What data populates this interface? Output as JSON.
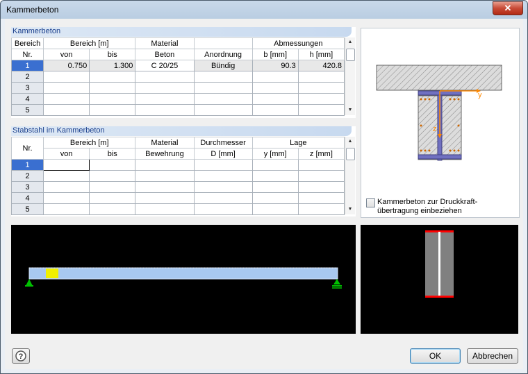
{
  "window": {
    "title": "Kammerbeton",
    "close_glyph": "✕"
  },
  "kammerbeton": {
    "panel_title": "Kammerbeton",
    "header_row1": [
      "Bereich",
      "Bereich [m]",
      "Material",
      "",
      "Abmessungen"
    ],
    "header_row2": [
      "Nr.",
      "von",
      "bis",
      "Beton",
      "Anordnung",
      "b [mm]",
      "h [mm]"
    ],
    "rows": [
      {
        "nr": "1",
        "von": "0.750",
        "bis": "1.300",
        "beton": "C 20/25",
        "anordnung": "Bündig",
        "b": "90.3",
        "h": "420.8"
      },
      {
        "nr": "2",
        "von": "",
        "bis": "",
        "beton": "",
        "anordnung": "",
        "b": "",
        "h": ""
      },
      {
        "nr": "3",
        "von": "",
        "bis": "",
        "beton": "",
        "anordnung": "",
        "b": "",
        "h": ""
      },
      {
        "nr": "4",
        "von": "",
        "bis": "",
        "beton": "",
        "anordnung": "",
        "b": "",
        "h": ""
      },
      {
        "nr": "5",
        "von": "",
        "bis": "",
        "beton": "",
        "anordnung": "",
        "b": "",
        "h": ""
      }
    ]
  },
  "stabstahl": {
    "panel_title": "Stabstahl im Kammerbeton",
    "header_row1": [
      "",
      "Bereich [m]",
      "Material",
      "Durchmesser",
      "Lage"
    ],
    "header_row2": [
      "Nr.",
      "von",
      "bis",
      "Bewehrung",
      "D [mm]",
      "y [mm]",
      "z [mm]"
    ],
    "rows": [
      {
        "nr": "1"
      },
      {
        "nr": "2"
      },
      {
        "nr": "3"
      },
      {
        "nr": "4"
      },
      {
        "nr": "5"
      }
    ]
  },
  "section_preview": {
    "axis_y": "y",
    "axis_z": "z"
  },
  "checkbox": {
    "label_line1": "Kammerbeton zur Druckkraft-",
    "label_line2": "übertragung einbeziehen",
    "checked": false
  },
  "buttons": {
    "help_icon": "help-icon",
    "ok": "OK",
    "cancel": "Abbrechen"
  },
  "colors": {
    "concrete_hatch": "#c0c0c0",
    "steel": "#7070c0",
    "beam": "#a8c8f0",
    "highlight": "#f0f000",
    "support": "#00c000",
    "accent": "#ff8800",
    "section_flange": "#ff0000"
  }
}
